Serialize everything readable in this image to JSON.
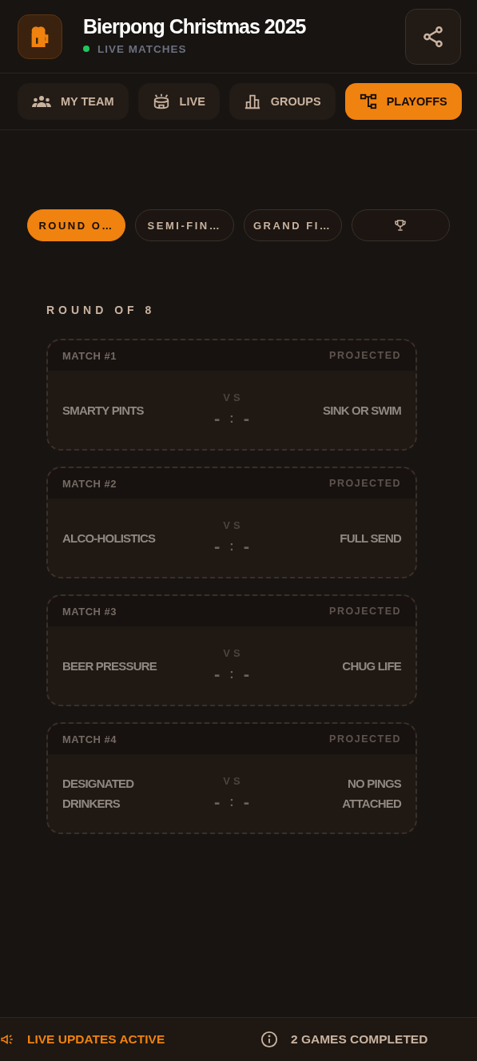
{
  "header": {
    "title": "Bierpong Christmas 2025",
    "status": {
      "label": "LIVE MATCHES",
      "live": true
    }
  },
  "tabs": [
    {
      "label": "MY TEAM",
      "kind": "team",
      "selected": false
    },
    {
      "label": "LIVE",
      "kind": "stadium",
      "selected": false
    },
    {
      "label": "GROUPS",
      "kind": "podium",
      "selected": false
    },
    {
      "label": "PLAYOFFS",
      "kind": "bracket",
      "selected": true
    }
  ],
  "rounds": [
    {
      "kind": "text",
      "label": "ROUND O…",
      "selected": true
    },
    {
      "kind": "text",
      "label": "SEMI-FIN…",
      "selected": false
    },
    {
      "kind": "text",
      "label": "GRAND FI…",
      "selected": false
    },
    {
      "kind": "trophy",
      "selected": false
    }
  ],
  "section_title": "ROUND OF 8",
  "matches": [
    {
      "label": "MATCH #1",
      "status": "PROJECTED",
      "home": "SMARTY PINTS",
      "vs": "VS",
      "score_home": "-",
      "separator": ":",
      "score_away": "-",
      "away": "SINK OR SWIM"
    },
    {
      "label": "MATCH #2",
      "status": "PROJECTED",
      "home": "ALCO-HOLISTICS",
      "vs": "VS",
      "score_home": "-",
      "separator": ":",
      "score_away": "-",
      "away": "FULL SEND"
    },
    {
      "label": "MATCH #3",
      "status": "PROJECTED",
      "home": "BEER PRESSURE",
      "vs": "VS",
      "score_home": "-",
      "separator": ":",
      "score_away": "-",
      "away": "CHUG LIFE"
    },
    {
      "label": "MATCH #4",
      "status": "PROJECTED",
      "home": "DESIGNATED DRINKERS",
      "vs": "VS",
      "score_home": "-",
      "separator": ":",
      "score_away": "-",
      "away": "NO PINGS ATTACHED"
    }
  ],
  "footer": {
    "live_updates": "LIVE UPDATES ACTIVE",
    "games_completed": "2 GAMES COMPLETED"
  }
}
